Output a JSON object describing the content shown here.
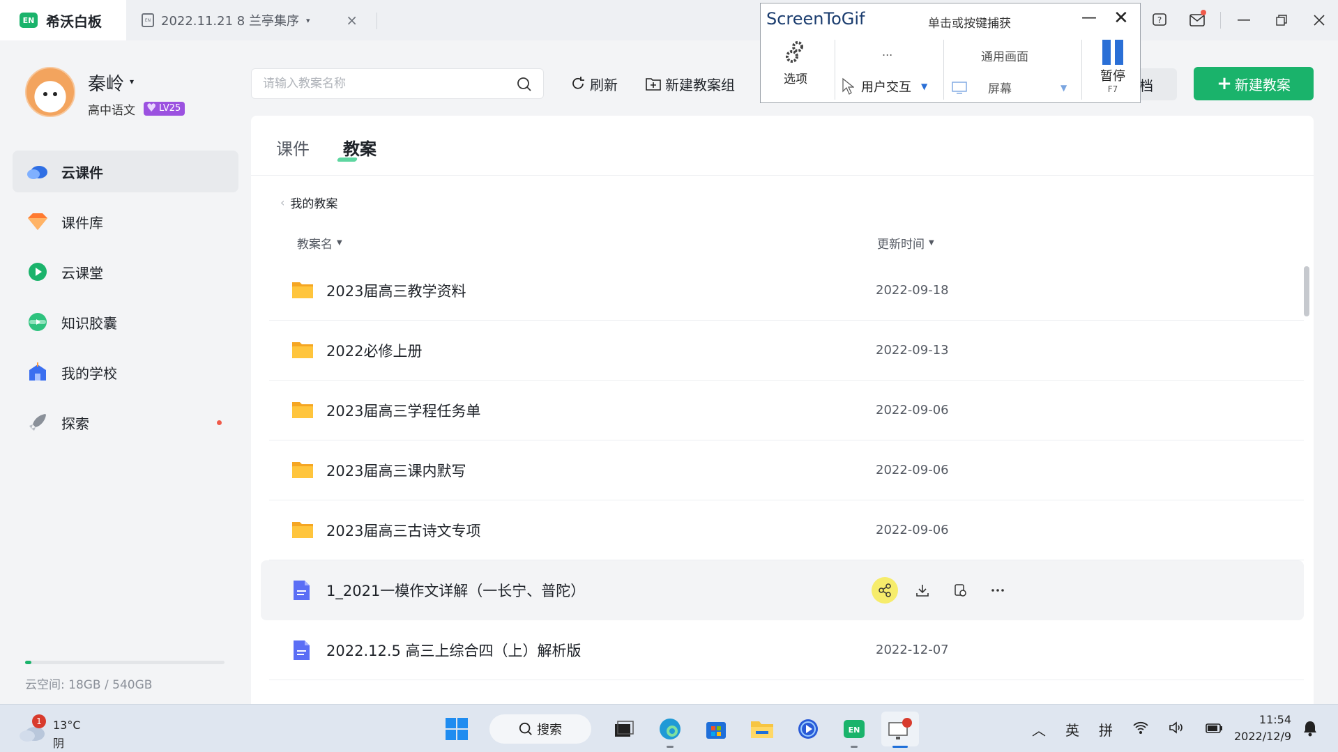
{
  "titlebar": {
    "app_logo": "EN",
    "app_name": "希沃白板",
    "doc_tab_icon": "EN",
    "doc_tab_title": "2022.11.21 8 兰亭集序",
    "doc_tab_close": "×"
  },
  "user": {
    "name": "秦岭",
    "subject": "高中语文",
    "level": "LV25"
  },
  "nav": [
    {
      "label": "云课件",
      "icon": "cloud-icon"
    },
    {
      "label": "课件库",
      "icon": "gem-icon"
    },
    {
      "label": "云课堂",
      "icon": "play-bubble-icon"
    },
    {
      "label": "知识胶囊",
      "icon": "capsule-icon"
    },
    {
      "label": "我的学校",
      "icon": "school-icon"
    },
    {
      "label": "探索",
      "icon": "rocket-icon"
    }
  ],
  "storage": {
    "label": "云空间:    18GB / 540GB",
    "used_fraction": 0.033
  },
  "toolbar": {
    "search_placeholder": "请输入教案名称",
    "refresh_label": "刷新",
    "new_group_label": "新建教案组",
    "partial_label": "档",
    "new_plan_label": "新建教案"
  },
  "tabs": {
    "courseware": "课件",
    "lesson_plans": "教案"
  },
  "breadcrumb": "我的教案",
  "columns": {
    "name": "教案名",
    "updated": "更新时间"
  },
  "rows": [
    {
      "name": "2023届高三教学资料",
      "date": "2022-09-18",
      "type": "folder"
    },
    {
      "name": "2022必修上册",
      "date": "2022-09-13",
      "type": "folder"
    },
    {
      "name": "2023届高三学程任务单",
      "date": "2022-09-06",
      "type": "folder"
    },
    {
      "name": "2023届高三课内默写",
      "date": "2022-09-06",
      "type": "folder"
    },
    {
      "name": "2023届高三古诗文专项",
      "date": "2022-09-06",
      "type": "folder"
    },
    {
      "name": "1_2021一模作文详解（一长宁、普陀）",
      "date": "",
      "type": "doc",
      "hover": true
    },
    {
      "name": "2022.12.5 高三上综合四（上）解析版",
      "date": "2022-12-07",
      "type": "doc"
    }
  ],
  "screentogif": {
    "title": "ScreenToGif",
    "hint": "单击或按键捕获",
    "options_label": "选项",
    "ellipsis": "...",
    "mode_label": "用户交互",
    "area_title": "通用画面",
    "area_label": "屏幕",
    "pause_label": "暂停",
    "pause_key": "F7"
  },
  "taskbar": {
    "weather_badge": "1",
    "temperature": "13°C",
    "weather": "阴",
    "search_label": "搜索",
    "ime_lang": "英",
    "ime_mode": "拼",
    "time": "11:54",
    "date": "2022/12/9"
  },
  "colors": {
    "accent": "#1ab36b",
    "level_badge": "#9b51e0",
    "folder": "#f7b733",
    "doc": "#5b6ef5"
  }
}
